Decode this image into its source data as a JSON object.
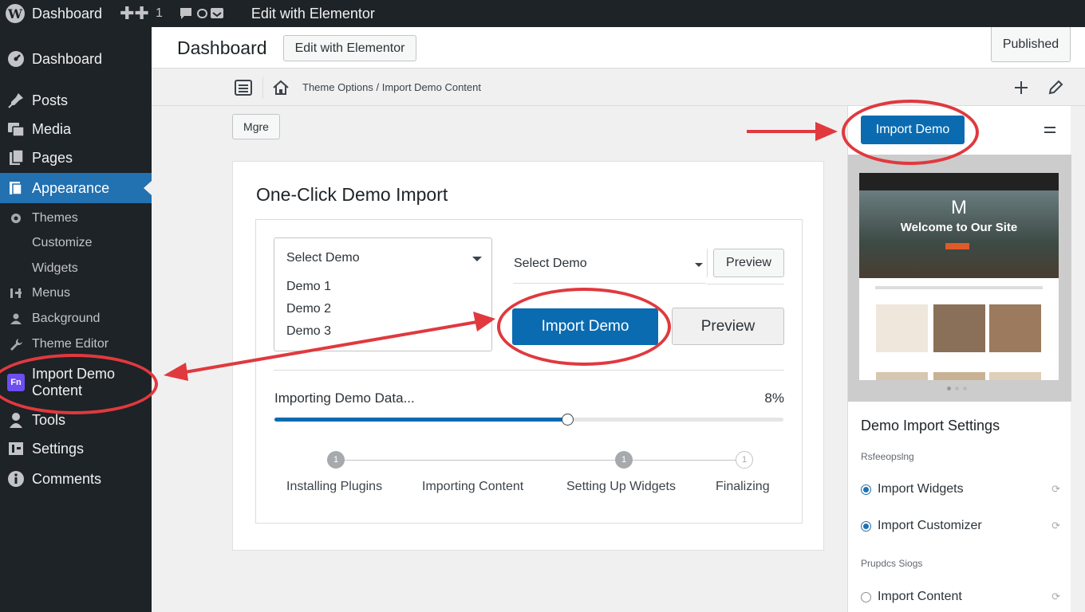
{
  "admin_bar": {
    "site_name": "Dashboard",
    "updates_count": "1",
    "edit_label": "Edit with Elementor"
  },
  "sidebar": {
    "items": [
      {
        "label": "Dashboard",
        "icon": "dashboard-icon"
      },
      {
        "label": "Posts",
        "icon": "pin-icon"
      },
      {
        "label": "Media",
        "icon": "media-icon"
      },
      {
        "label": "Pages",
        "icon": "pages-icon"
      },
      {
        "label": "Appearance",
        "icon": "brush-icon",
        "active": true
      },
      {
        "label": "Import Demo Content",
        "icon": "fn-badge-icon",
        "badge_text": "Fn"
      },
      {
        "label": "Tools",
        "icon": "wrench-icon"
      },
      {
        "label": "Settings",
        "icon": "settings-icon"
      },
      {
        "label": "Comments",
        "icon": "info-icon"
      }
    ],
    "submenu": [
      "Themes",
      "Customize",
      "Widgets",
      "Menus",
      "Background",
      "Theme Editor"
    ]
  },
  "header": {
    "title": "Dashboard",
    "edit_button": "Edit with Elementor",
    "status_button": "Published"
  },
  "toolbar": {
    "breadcrumb": "Theme Options / Import Demo Content",
    "more_button": "Mgre"
  },
  "main": {
    "title": "One-Click Demo Import",
    "select_label": "Select Demo",
    "options": [
      "Demo 1",
      "Demo 2",
      "Demo 3"
    ],
    "select2_value": "Select Demo",
    "preview_small": "Preview",
    "import_button": "Import Demo",
    "preview_large": "Preview",
    "progress_label": "Importing Demo Data...",
    "progress_text": "8%",
    "progress_fill": 0.575,
    "steps": [
      {
        "label": "Installing Plugins",
        "num": "1",
        "state": "done"
      },
      {
        "label": "Importing Content",
        "num": "",
        "state": "none"
      },
      {
        "label": "Setting Up Widgets",
        "num": "1",
        "state": "done"
      },
      {
        "label": "Finalizing",
        "num": "1",
        "state": "pending"
      }
    ]
  },
  "right_panel": {
    "import_button": "Import Demo",
    "preview": {
      "logo": "M",
      "headline": "Welcome to Our Site"
    },
    "settings_title": "Demo Import Settings",
    "group1_label": "Rsfeeopslng",
    "options": [
      {
        "label": "Import Widgets",
        "checked": true
      },
      {
        "label": "Import Customizer",
        "checked": true
      }
    ],
    "group2_label": "Prupdcs Siogs",
    "options2": [
      {
        "label": "Import Content",
        "checked": false
      }
    ]
  },
  "colors": {
    "admin_dark": "#1d2327",
    "accent_blue": "#2271b1",
    "primary_button": "#0a6bb0",
    "annotation_red": "#e0393e"
  }
}
